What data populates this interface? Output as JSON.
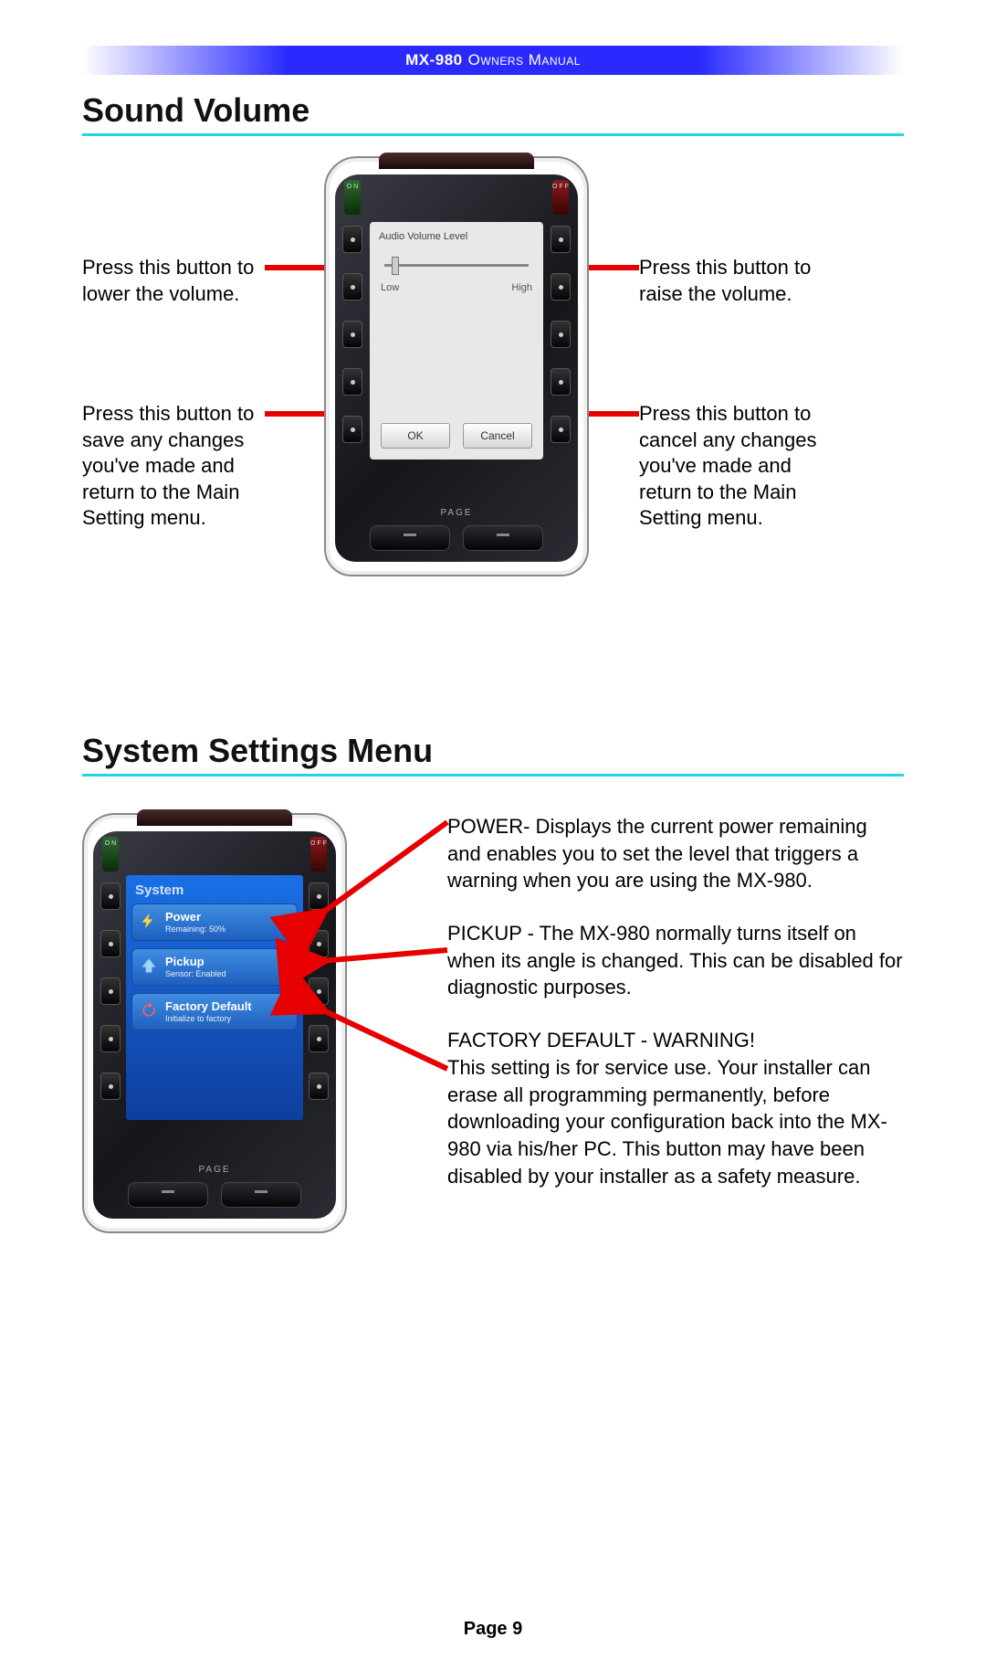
{
  "header": {
    "product": "MX-980",
    "doc": "Owners Manual"
  },
  "sections": {
    "sound_volume": {
      "title": "Sound Volume"
    },
    "system_settings": {
      "title": "System Settings Menu"
    }
  },
  "callouts": {
    "lower": "Press this button to lower the vol­ume.",
    "raise": "Press this button to raise the vol­ume.",
    "save": "Press this button to save any changes you've made and return to the Main Setting menu.",
    "cancel": "Press this button to cancel any changes you've made and return to the Main Setting menu."
  },
  "remote_ui": {
    "on_label": "O\nN",
    "off_label": "O\nF\nF",
    "page_label": "PAGE",
    "sound_screen": {
      "title": "Audio Volume Level",
      "low": "Low",
      "high": "High",
      "ok": "OK",
      "cancel": "Cancel"
    },
    "system_screen": {
      "header": "System",
      "items": [
        {
          "title": "Power",
          "subtitle": "Remaining: 50%",
          "icon": "bolt"
        },
        {
          "title": "Pickup",
          "subtitle": "Sensor: Enabled",
          "icon": "up"
        },
        {
          "title": "Factory Default",
          "subtitle": "Initialize to factory",
          "icon": "reset"
        }
      ]
    }
  },
  "system_text": {
    "power": "POWER- Displays the current power remaining and enables you to set the level that triggers a warning when you are using the MX-980.",
    "pickup": "PICKUP - The MX-980 normally turns itself on when its angle is changed. This can be disabled for diagnostic purposes.",
    "factory_lead": "FACTORY DEFAULT - WARNING!",
    "factory_body": "This setting is for service use. Your installer can erase all programming per­manently, before downloading your configuration back into the MX-980 via his/her PC. This button may have been disabled by your installer as a safety measure."
  },
  "footer": {
    "page": "Page 9"
  }
}
